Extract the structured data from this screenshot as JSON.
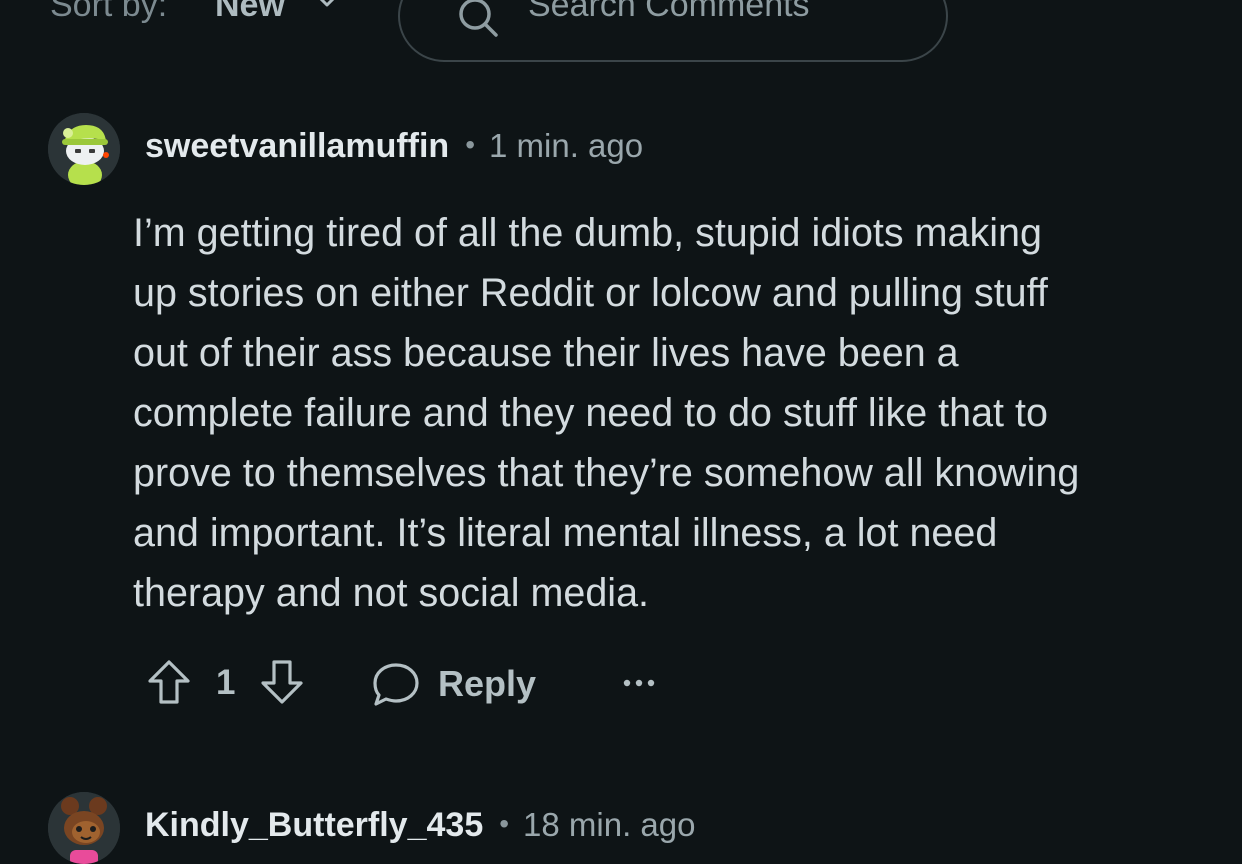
{
  "toolbar": {
    "sort_label": "Sort by:",
    "sort_value": "New",
    "search_placeholder": "Search Comments"
  },
  "comments": [
    {
      "username": "sweetvanillamuffin",
      "timestamp": "1 min. ago",
      "body_lines": [
        "I’m getting tired of all the dumb, stupid idiots making",
        "up stories on either Reddit or lolcow and pulling stuff",
        "out of their ass because their lives have been a",
        "complete failure and they need to do stuff like that to",
        "prove to themselves that they’re somehow all knowing",
        "and important. It’s literal mental illness, a lot need",
        "therapy and not social media."
      ],
      "vote_count": "1",
      "reply_label": "Reply"
    },
    {
      "username": "Kindly_Butterfly_435",
      "timestamp": "18 min. ago"
    }
  ],
  "separator": "•",
  "icons": {
    "sort": "chevron-down-icon",
    "search": "search-icon",
    "upvote": "upvote-arrow-icon",
    "downvote": "downvote-arrow-icon",
    "reply": "speech-bubble-icon",
    "more": "more-options-icon"
  },
  "colors": {
    "background": "#0e1416",
    "text_primary": "#e3e9ec",
    "text_muted": "#9aa7ac"
  }
}
